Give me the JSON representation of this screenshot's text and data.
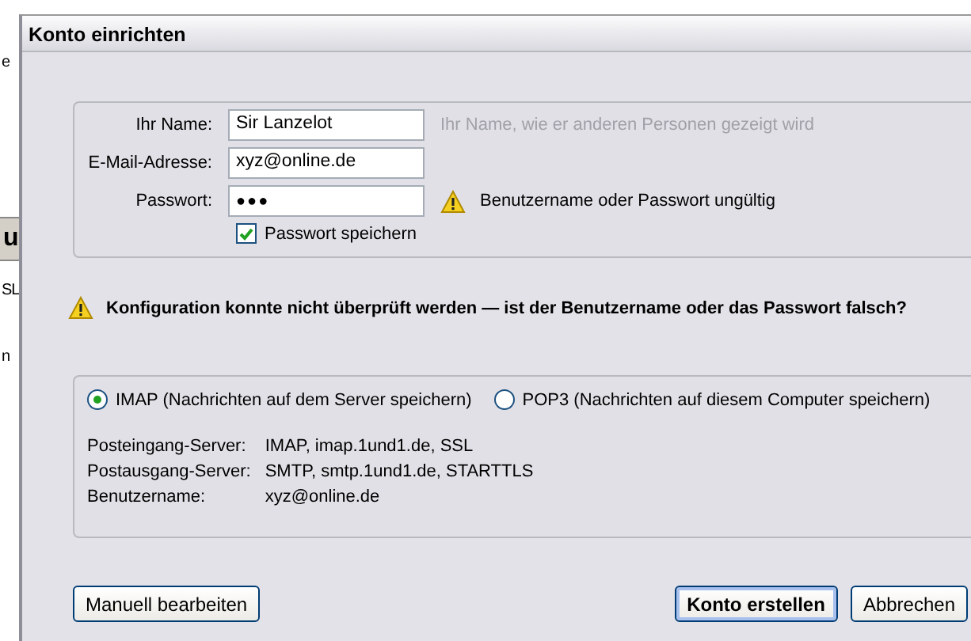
{
  "background_window": {
    "fragments": [
      {
        "text": "e",
        "kind": "plain"
      },
      {
        "text": "u",
        "kind": "header"
      },
      {
        "text": "SL",
        "kind": "plain"
      },
      {
        "text": "n",
        "kind": "plain"
      }
    ]
  },
  "window": {
    "title": "Konto einrichten"
  },
  "account_form": {
    "fields": [
      {
        "label": "Ihr Name:",
        "value": "Sir Lanzelot",
        "hint": "Ihr Name, wie er anderen Personen gezeigt wird",
        "kind": "text"
      },
      {
        "label": "E-Mail-Adresse:",
        "value": "xyz@online.de",
        "kind": "text"
      },
      {
        "label": "Passwort:",
        "value": "●●●",
        "warning": "Benutzername oder Passwort ungültig",
        "kind": "password"
      }
    ],
    "remember_password": {
      "label": "Passwort speichern",
      "checked": true
    }
  },
  "error_message": "Konfiguration konnte nicht überprüft werden — ist der Benutzername oder das Passwort falsch?",
  "server_settings": {
    "protocols": [
      {
        "label": "IMAP (Nachrichten auf dem Server speichern)",
        "selected": true
      },
      {
        "label": "POP3 (Nachrichten auf diesem Computer speichern)",
        "selected": false
      }
    ],
    "details": [
      {
        "label": "Posteingang-Server:",
        "value": "IMAP, imap.1und1.de, SSL"
      },
      {
        "label": "Postausgang-Server:",
        "value": "SMTP, smtp.1und1.de, STARTTLS"
      },
      {
        "label": "Benutzername:",
        "value": "xyz@online.de"
      }
    ]
  },
  "buttons": [
    {
      "label": "Manuell bearbeiten",
      "default": false
    },
    {
      "label": "Konto erstellen",
      "default": true
    },
    {
      "label": "Abbrechen",
      "default": false
    }
  ]
}
